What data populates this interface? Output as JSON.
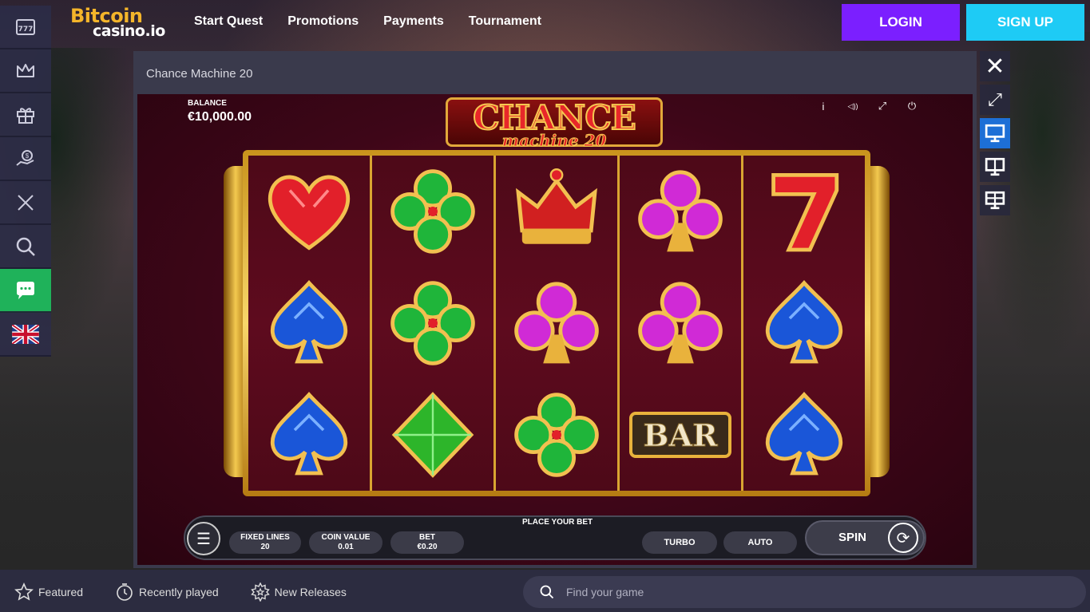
{
  "brand": {
    "line1": "Bitcoin",
    "line2": "casino.io"
  },
  "nav": {
    "items": [
      "Start Quest",
      "Promotions",
      "Payments",
      "Tournament"
    ]
  },
  "auth": {
    "login": "LOGIN",
    "signup": "SIGN UP"
  },
  "sidebar": {
    "items": [
      "slots-icon",
      "crown-icon",
      "gift-icon",
      "money-bag-icon",
      "swords-icon",
      "search-icon",
      "chat-icon",
      "uk-flag-icon"
    ]
  },
  "modal": {
    "title": "Chance Machine 20"
  },
  "game": {
    "balance_label": "BALANCE",
    "balance_value": "€10,000.00",
    "title_main": "CHANCE",
    "title_sub": "machine 20",
    "reels": [
      [
        "heart",
        "spade",
        "spade"
      ],
      [
        "clover",
        "clover",
        "diamond"
      ],
      [
        "crown",
        "club",
        "clover"
      ],
      [
        "club",
        "club",
        "bar"
      ],
      [
        "seven",
        "spade",
        "spade"
      ]
    ],
    "bar_text": "BAR",
    "place_bet": "PLACE YOUR BET",
    "fixed_lines_label": "FIXED LINES",
    "fixed_lines_value": "20",
    "coin_value_label": "COIN VALUE",
    "coin_value_value": "0.01",
    "bet_label": "BET",
    "bet_value": "€0.20",
    "turbo": "TURBO",
    "auto": "AUTO",
    "spin": "SPIN",
    "top_icons": {
      "info": "i",
      "sound": "◁))",
      "fullscreen": "⤢",
      "power": "⏻"
    }
  },
  "tools": [
    "close-icon",
    "expand-icon",
    "single-screen-icon",
    "dual-screen-icon",
    "quad-screen-icon"
  ],
  "bottom": {
    "tabs": [
      "Featured",
      "Recently played",
      "New Releases"
    ],
    "search_placeholder": "Find your game"
  },
  "colors": {
    "login": "#7b1fff",
    "signup": "#1ecbf5",
    "chat": "#1fb25a",
    "active_tool": "#1d6fd6"
  }
}
